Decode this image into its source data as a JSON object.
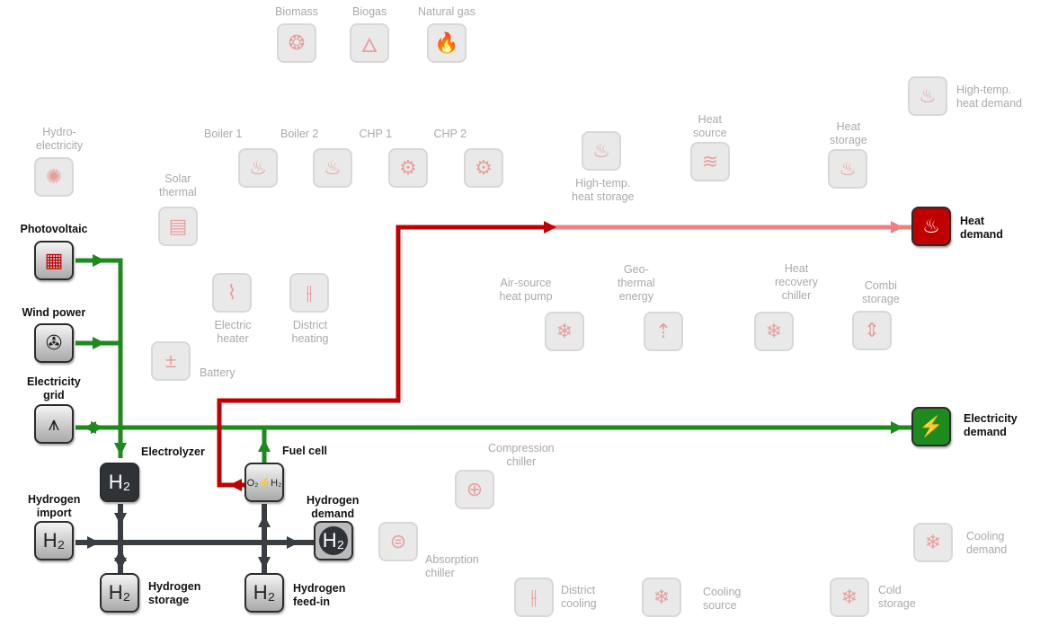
{
  "colors": {
    "electricity": "#1e8a1e",
    "heat": "#c00000",
    "heat_inactive": "#f08080",
    "hydrogen": "#3a3d42",
    "inactive_label": "#aaaaaa"
  },
  "nodes": [
    {
      "id": "biomass",
      "label": "Biomass",
      "icon": "logs-icon",
      "glyph": "❂",
      "active": false
    },
    {
      "id": "biogas",
      "label": "Biogas",
      "icon": "bio-flame-icon",
      "glyph": "🜂",
      "active": false
    },
    {
      "id": "natural-gas",
      "label": "Natural gas",
      "icon": "flame-icon",
      "glyph": "🔥",
      "active": false
    },
    {
      "id": "hydro",
      "label": "Hydro-\nelectricity",
      "icon": "water-wheel-icon",
      "glyph": "✺",
      "active": false
    },
    {
      "id": "solar-thermal",
      "label": "Solar\nthermal",
      "icon": "solar-collector-icon",
      "glyph": "▤",
      "active": false
    },
    {
      "id": "boiler1",
      "label": "Boiler 1",
      "icon": "boiler-icon",
      "glyph": "♨",
      "active": false
    },
    {
      "id": "boiler2",
      "label": "Boiler 2",
      "icon": "boiler-icon",
      "glyph": "♨",
      "active": false
    },
    {
      "id": "chp1",
      "label": "CHP 1",
      "icon": "chp-engine-icon",
      "glyph": "⚙",
      "active": false
    },
    {
      "id": "chp2",
      "label": "CHP 2",
      "icon": "chp-engine-icon",
      "glyph": "⚙",
      "active": false
    },
    {
      "id": "ht-storage",
      "label": "High-temp.\nheat storage",
      "icon": "heat-tank-icon",
      "glyph": "♨",
      "active": false
    },
    {
      "id": "heat-source",
      "label": "Heat\nsource",
      "icon": "heat-source-icon",
      "glyph": "≋",
      "active": false
    },
    {
      "id": "heat-storage",
      "label": "Heat\nstorage",
      "icon": "heat-tank-icon",
      "glyph": "♨",
      "active": false
    },
    {
      "id": "ht-demand",
      "label": "High-temp.\nheat demand",
      "icon": "heat-waves-icon",
      "glyph": "♨",
      "active": false
    },
    {
      "id": "electric-heater",
      "label": "Electric\nheater",
      "icon": "electric-heater-icon",
      "glyph": "⌇",
      "active": false
    },
    {
      "id": "district-heating",
      "label": "District\nheating",
      "icon": "district-heating-icon",
      "glyph": "⫲",
      "active": false
    },
    {
      "id": "battery",
      "label": "Battery",
      "icon": "battery-icon",
      "glyph": "±",
      "active": false
    },
    {
      "id": "ashp",
      "label": "Air-source\nheat pump",
      "icon": "heat-pump-icon",
      "glyph": "❄",
      "active": false
    },
    {
      "id": "geothermal",
      "label": "Geo-\nthermal\nenergy",
      "icon": "geothermal-icon",
      "glyph": "⇡",
      "active": false
    },
    {
      "id": "hr-chiller",
      "label": "Heat\nrecovery\nchiller",
      "icon": "chiller-icon",
      "glyph": "❄",
      "active": false
    },
    {
      "id": "combi-storage",
      "label": "Combi\nstorage",
      "icon": "combi-tank-icon",
      "glyph": "⇕",
      "active": false
    },
    {
      "id": "compression-chiller",
      "label": "Compression\nchiller",
      "icon": "compressor-icon",
      "glyph": "⊕",
      "active": false
    },
    {
      "id": "absorption-chiller",
      "label": "Absorption\nchiller",
      "icon": "absorption-icon",
      "glyph": "⊜",
      "active": false
    },
    {
      "id": "district-cooling",
      "label": "District\ncooling",
      "icon": "district-cooling-icon",
      "glyph": "⫲",
      "active": false
    },
    {
      "id": "cooling-source",
      "label": "Cooling\nsource",
      "icon": "snowflake-icon",
      "glyph": "❄",
      "active": false
    },
    {
      "id": "cold-storage",
      "label": "Cold\nstorage",
      "icon": "cold-tank-icon",
      "glyph": "❄",
      "active": false
    },
    {
      "id": "cooling-demand",
      "label": "Cooling\ndemand",
      "icon": "snowflake-icon",
      "glyph": "❄",
      "active": false
    },
    {
      "id": "pv",
      "label": "Photovoltaic",
      "icon": "solar-panel-icon",
      "glyph": "▦",
      "active": true
    },
    {
      "id": "wind",
      "label": "Wind power",
      "icon": "wind-turbine-icon",
      "glyph": "✇",
      "active": true
    },
    {
      "id": "grid",
      "label": "Electricity\ngrid",
      "icon": "power-pylon-icon",
      "glyph": "⩚",
      "active": true
    },
    {
      "id": "electrolyzer",
      "label": "Electrolyzer",
      "icon": "electrolyzer-icon",
      "glyph": "H₂",
      "active": true,
      "dark": true
    },
    {
      "id": "h2-import",
      "label": "Hydrogen\nimport",
      "icon": "valve-icon",
      "glyph": "H₂",
      "active": true
    },
    {
      "id": "h2-storage",
      "label": "Hydrogen\nstorage",
      "icon": "h2-tank-icon",
      "glyph": "H₂",
      "active": true
    },
    {
      "id": "fuel-cell",
      "label": "Fuel cell",
      "icon": "fuel-cell-icon",
      "glyph": "O₂⚡H₂",
      "active": true
    },
    {
      "id": "h2-demand",
      "label": "Hydrogen\ndemand",
      "icon": "h2-circle-icon",
      "glyph": "H₂",
      "active": true
    },
    {
      "id": "h2-feedin",
      "label": "Hydrogen\nfeed-in",
      "icon": "h2-feedin-icon",
      "glyph": "H₂",
      "active": true
    },
    {
      "id": "heat-demand",
      "label": "Heat\ndemand",
      "icon": "heat-waves-icon",
      "glyph": "♨",
      "active": true
    },
    {
      "id": "elec-demand",
      "label": "Electricity\ndemand",
      "icon": "lightning-icon",
      "glyph": "⚡",
      "active": true
    }
  ]
}
